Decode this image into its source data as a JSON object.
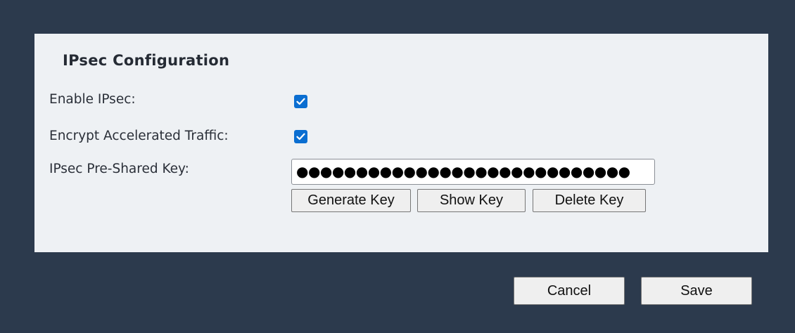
{
  "panel": {
    "title": "IPsec Configuration"
  },
  "fields": {
    "enable_ipsec": {
      "label": "Enable IPsec:",
      "checked": true
    },
    "encrypt_accelerated": {
      "label": "Encrypt Accelerated Traffic:",
      "checked": true
    },
    "psk": {
      "label": "IPsec Pre-Shared Key:",
      "value": "●●●●●●●●●●●●●●●●●●●●●●●●●●●●"
    }
  },
  "key_buttons": {
    "generate": "Generate Key",
    "show": "Show Key",
    "delete": "Delete Key"
  },
  "footer": {
    "cancel": "Cancel",
    "save": "Save"
  },
  "colors": {
    "background": "#2c3a4d",
    "panel": "#eef1f4",
    "checkbox_accent": "#0a6ed1"
  },
  "icons": {
    "checkmark": "checkmark-icon"
  }
}
